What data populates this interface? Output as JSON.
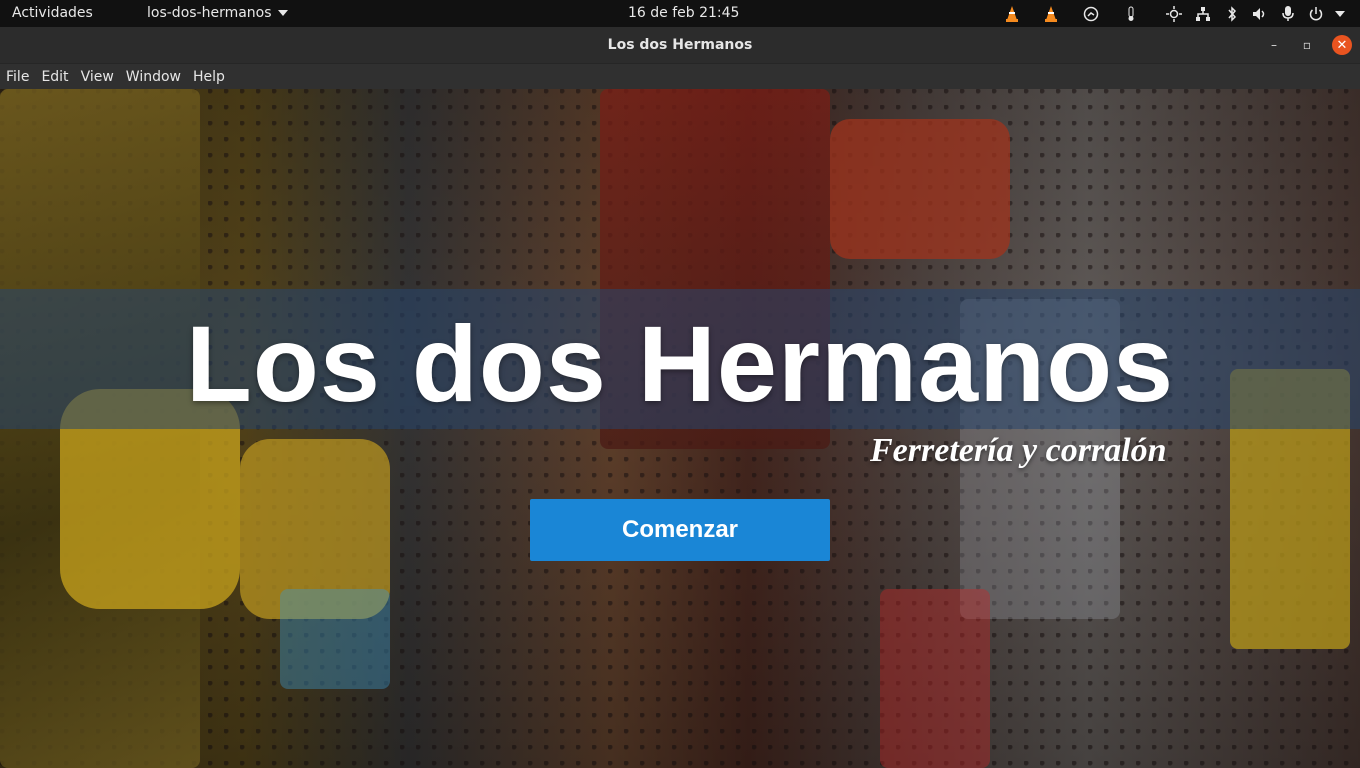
{
  "topbar": {
    "activities": "Actividades",
    "app_menu": "los-dos-hermanos",
    "clock": "16 de feb  21:45",
    "tray_icons": [
      "vlc-icon",
      "vlc-icon",
      "network-icon",
      "bluetooth-icon",
      "brightness-icon",
      "network-wired-icon",
      "bluetooth-icon",
      "volume-icon",
      "microphone-icon",
      "power-icon",
      "chevron-down-icon"
    ]
  },
  "window": {
    "title": "Los dos Hermanos",
    "minimize": "–",
    "maximize": "▫",
    "close": "✕"
  },
  "menubar": {
    "items": [
      "File",
      "Edit",
      "View",
      "Window",
      "Help"
    ]
  },
  "hero": {
    "title": "Los dos Hermanos",
    "subtitle": "Ferretería y corralón",
    "cta_label": "Comenzar"
  },
  "colors": {
    "accent": "#1a86d6",
    "close_button": "#e95420",
    "band": "#26466e"
  }
}
